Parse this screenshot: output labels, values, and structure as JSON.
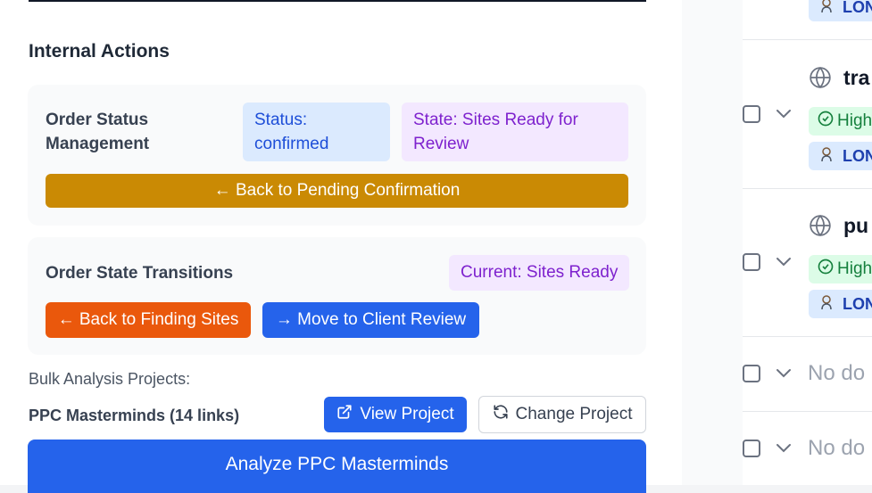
{
  "internal_actions": {
    "title": "Internal Actions",
    "order_status": {
      "label": "Order Status Management",
      "status_pill": "Status: confirmed",
      "state_pill": "State: Sites Ready for Review",
      "back_button": "← Back to Pending Confirmation"
    },
    "state_transitions": {
      "label": "Order State Transitions",
      "current_pill": "Current: Sites Ready",
      "back_finding_button": "← Back to Finding Sites",
      "move_review_button": "→ Move to Client Review"
    },
    "bulk": {
      "heading": "Bulk Analysis Projects:",
      "project_name": "PPC Masterminds (14 links)",
      "view_button": "View Project",
      "change_button": "Change Project",
      "analyze_button": "Analyze PPC Masterminds"
    }
  },
  "right_panel": {
    "rows": [
      {
        "type": "partial",
        "badge": "LON"
      },
      {
        "type": "item",
        "title": "tra",
        "priority": "High",
        "badge": "LON"
      },
      {
        "type": "item",
        "title": "pu",
        "priority": "High",
        "badge": "LON"
      },
      {
        "type": "empty",
        "text": "No do"
      },
      {
        "type": "empty",
        "text": "No do"
      }
    ]
  },
  "colors": {
    "amber": "#ca8a04",
    "orange": "#ea580c",
    "blue": "#2563eb",
    "status_blue_bg": "#dbeafe",
    "state_purple_bg": "#f3e8ff"
  }
}
